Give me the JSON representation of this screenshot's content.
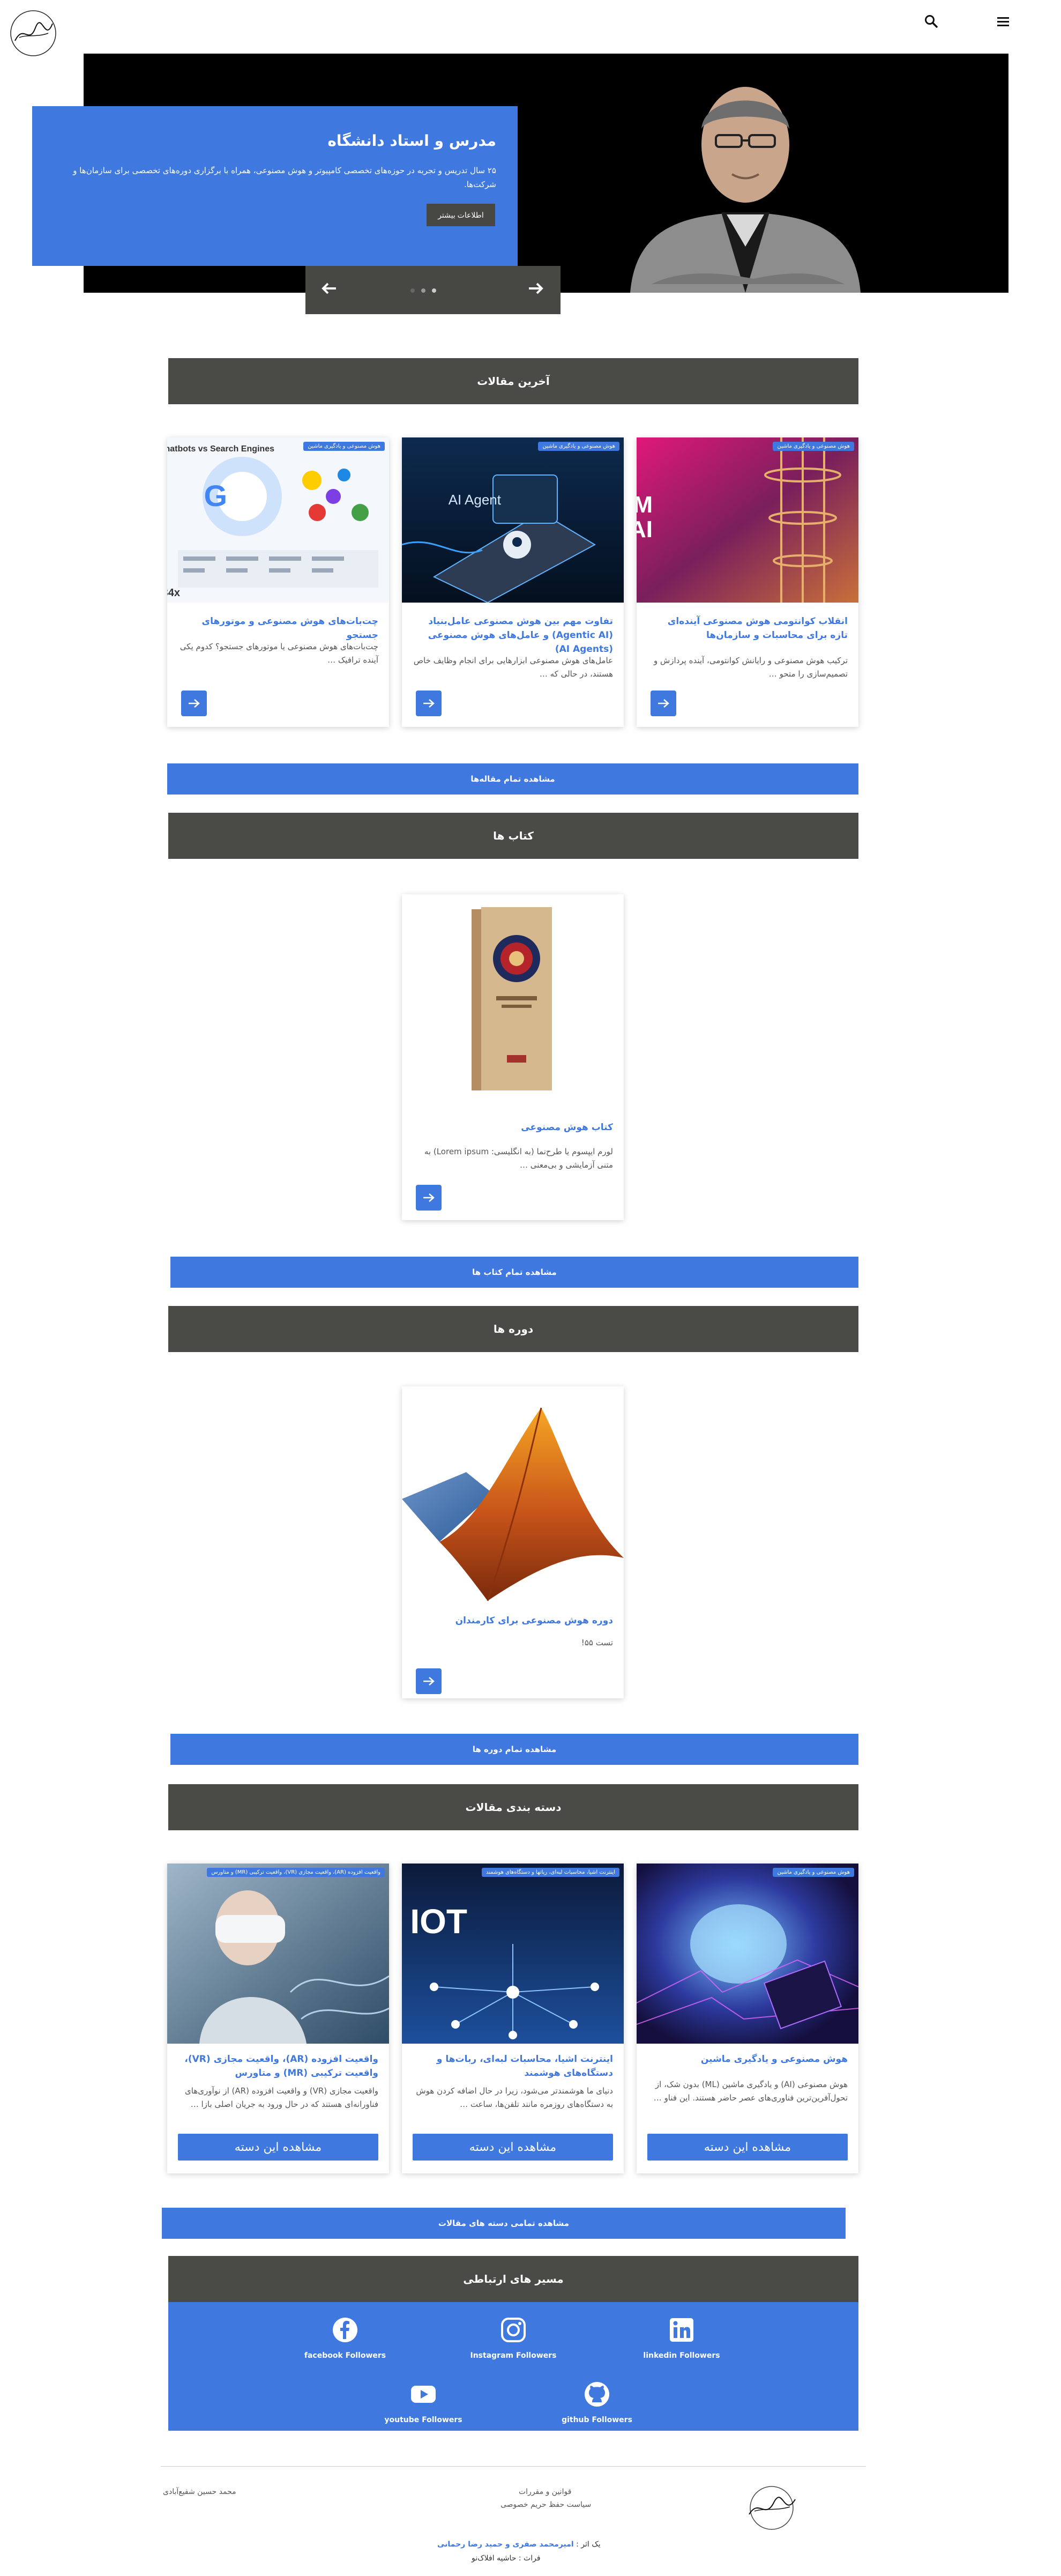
{
  "header": {
    "logo_alt": "signature-logo",
    "search_icon": "search-icon",
    "menu_icon": "hamburger-menu-icon"
  },
  "hero": {
    "title": "مدرس و استاد دانشگاه",
    "text": "۲۵ سال تدریس و تجربه در حوزه‌های تخصصی کامپیوتر و هوش مصنوعی، همراه با برگزاری دوره‌های تخصصی برای سازمان‌ها و شرکت‌ها.",
    "button": "اطلاعات بیشتر",
    "prev_icon": "arrow-left-icon",
    "next_icon": "arrow-right-icon"
  },
  "articles": {
    "heading": "آخرین مقالات",
    "items": [
      {
        "badge": "هوش مصنوعی و یادگیری ماشین",
        "title": "انقلاب کوانتومی هوش مصنوعی آینده‌ای تازه برای محاسبات و سازمان‌ها",
        "excerpt": "ترکیب هوش مصنوعی و رایانش کوانتومی، آینده پردازش و تصمیم‌سازی را متحو …",
        "image_text": "QUANTUM AI"
      },
      {
        "badge": "هوش مصنوعی و یادگیری ماشین",
        "title": "تفاوت مهم بین هوش مصنوعی عامل‌بنیاد (Agentic AI) و عامل‌های هوش مصنوعی (AI Agents)",
        "excerpt": "عامل‌های هوش مصنوعی ابزارهایی برای انجام وظایف خاص هستند، در حالی که …",
        "image_text": "AI Agent"
      },
      {
        "badge": "هوش مصنوعی و یادگیری ماشین",
        "title": "چت‌بات‌های هوش مصنوعی و موتورهای جستجو",
        "excerpt": "چت‌بات‌های هوش مصنوعی یا موتورهای جستجو؟ کدوم یکی آینده ترافیک …",
        "image_text": "Chatbots vs Search Engines"
      }
    ],
    "view_all": "مشاهده تمام مقاله‌ها"
  },
  "books": {
    "heading": "کتاب ها",
    "items": [
      {
        "title": "کتاب هوش مصنوعی",
        "excerpt": "لورم ایپسوم یا طرح‌نما (به انگلیسی: Lorem ipsum) به متنی آزمایشی و بی‌معنی …"
      }
    ],
    "view_all": "مشاهده تمام کتاب ها"
  },
  "courses": {
    "heading": "دوره ها",
    "items": [
      {
        "title": "دوره هوش مصنوعی برای کارمندان",
        "excerpt": "تست ۵۵!"
      }
    ],
    "view_all": "مشاهده تمام دوره ها"
  },
  "categories": {
    "heading": "دسته بندی مقالات",
    "items": [
      {
        "badge": "هوش مصنوعی و یادگیری ماشین",
        "title": "هوش مصنوعی و یادگیری ماشین",
        "excerpt": "هوش مصنوعی (AI) و یادگیری ماشین (ML) بدون شک، از تحول‌آفرین‌ترین فناوری‌های عصر حاضر هستند. این فناو …",
        "button": "مشاهده این دسته"
      },
      {
        "badge": "اینترنت اشیا، محاسبات لبه‌ای، رباتها و دستگاه‌های هوشمند",
        "title": "اینترنت اشیا، محاسبات لبه‌ای، ربات‌ها و دستگاه‌های هوشمند",
        "excerpt": "دنیای ما هوشمندتر می‌شود، زیرا در حال اضافه کردن هوش به دستگاه‌های روزمره مانند تلفن‌ها، ساعت …",
        "button": "مشاهده این دسته",
        "image_text": "IOT"
      },
      {
        "badge": "واقعیت افزوده (AR)، واقعیت مجازی (VR)، واقعیت ترکیبی (MR) و متاورس",
        "title": "واقعیت افزوده (AR)، واقعیت مجازی (VR)، واقعیت ترکیبی (MR) و متاورس",
        "excerpt": "واقعیت مجازی (VR) و واقعیت افزوده (AR) از نوآوری‌های فناورانه‌ای هستند که در حال ورود به جریان اصلی بازا …",
        "button": "مشاهده این دسته"
      }
    ],
    "view_all": "مشاهده تمامی دسته های مقالات"
  },
  "contacts": {
    "heading": "مسیر های ارتباطی",
    "items": [
      {
        "label": "facebook Followers",
        "icon": "facebook-icon"
      },
      {
        "label": "Instagram Followers",
        "icon": "instagram-icon"
      },
      {
        "label": "linkedin Followers",
        "icon": "linkedin-icon"
      },
      {
        "label": "youtube Followers",
        "icon": "youtube-icon"
      },
      {
        "label": "github Followers",
        "icon": "github-icon"
      }
    ]
  },
  "footer": {
    "name": "محمد حسین شفیع‌آبادی",
    "links": [
      "قوانین و مقررات",
      "سیاست حفظ حریم خصوصی"
    ],
    "credit_prefix": "یک اثر :",
    "credit_names": "امیرمحمد صفری و حمید رضا رحمانی",
    "partner_prefix": "فراث :",
    "partner_name": "حاشیه افلاک‌نو"
  },
  "colors": {
    "accent": "#3f78de",
    "dark_bar": "#4a4a46",
    "hero_bg": "#000000"
  }
}
